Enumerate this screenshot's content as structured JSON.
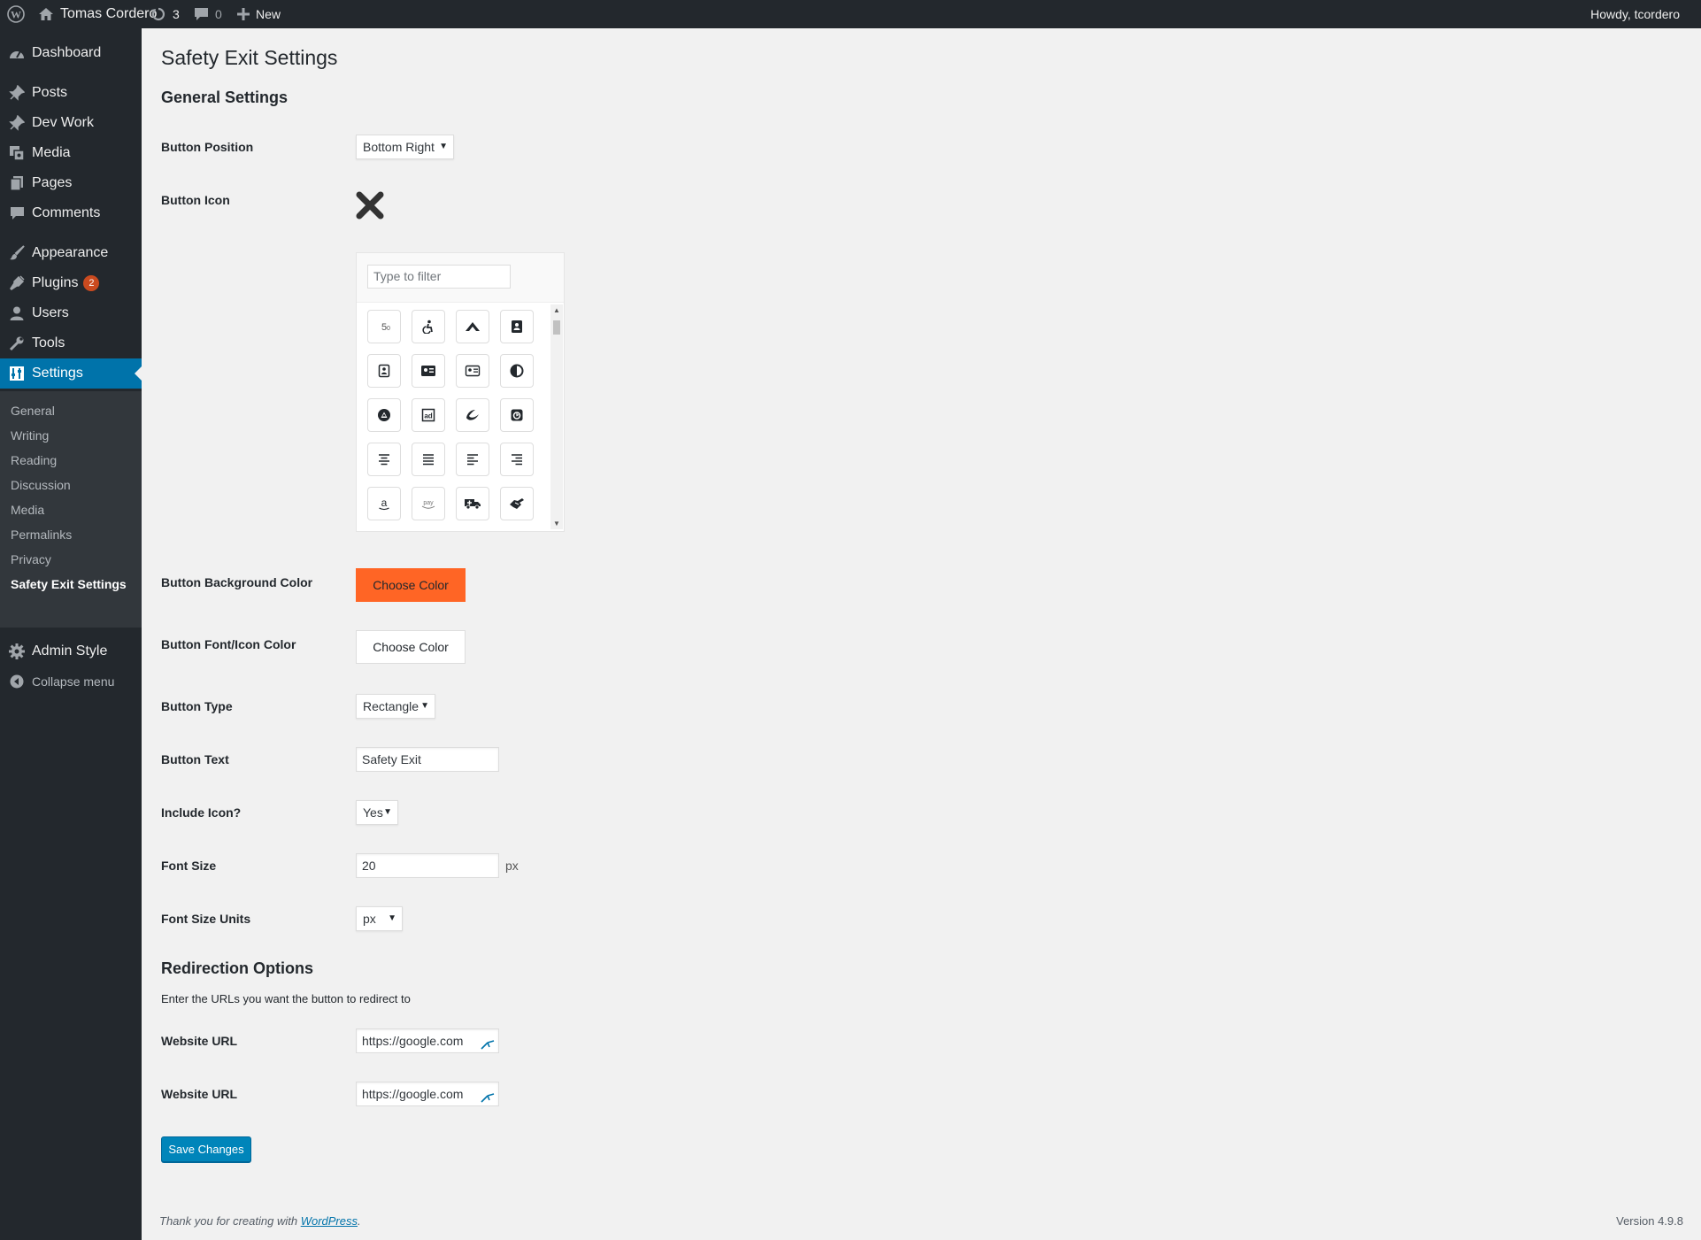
{
  "admin_bar": {
    "site_name": "Tomas Cordero",
    "updates_count": "3",
    "comments_count": "0",
    "new_label": "New",
    "greeting": "Howdy, tcordero"
  },
  "sidebar": {
    "items": [
      {
        "label": "Dashboard",
        "icon": "dashboard-icon"
      },
      {
        "label": "Posts",
        "icon": "pin-icon"
      },
      {
        "label": "Dev Work",
        "icon": "pin-icon"
      },
      {
        "label": "Media",
        "icon": "media-icon"
      },
      {
        "label": "Pages",
        "icon": "pages-icon"
      },
      {
        "label": "Comments",
        "icon": "comment-icon"
      },
      {
        "label": "Appearance",
        "icon": "brush-icon"
      },
      {
        "label": "Plugins",
        "icon": "plugin-icon",
        "badge": "2"
      },
      {
        "label": "Users",
        "icon": "user-icon"
      },
      {
        "label": "Tools",
        "icon": "wrench-icon"
      },
      {
        "label": "Settings",
        "icon": "settings-icon"
      }
    ],
    "submenu": [
      "General",
      "Writing",
      "Reading",
      "Discussion",
      "Media",
      "Permalinks",
      "Privacy",
      "Safety Exit Settings"
    ],
    "admin_style": "Admin Style",
    "collapse": "Collapse menu"
  },
  "page": {
    "title": "Safety Exit Settings",
    "general_heading": "General Settings",
    "button_position_label": "Button Position",
    "button_position_value": "Bottom Right",
    "button_icon_label": "Button Icon",
    "filter_placeholder": "Type to filter",
    "icon_grid": [
      [
        "500px-icon",
        "accessible-icon",
        "accusoft-icon",
        "address-book-icon"
      ],
      [
        "address-card-icon",
        "address-card-solid-icon",
        "id-card-icon",
        "adjust-icon"
      ],
      [
        "adn-icon",
        "adversal-icon",
        "affiliatetheme-icon",
        "algolia-icon"
      ],
      [
        "align-center-icon",
        "align-justify-icon",
        "align-left-icon",
        "align-right-icon"
      ],
      [
        "amazon-icon",
        "amazon-pay-icon",
        "ambulance-icon",
        "american-sign-language-icon"
      ]
    ],
    "bg_color_label": "Button Background Color",
    "bg_color_button": "Choose Color",
    "bg_color_value": "#ff6525",
    "font_color_label": "Button Font/Icon Color",
    "font_color_button": "Choose Color",
    "font_color_value": "#ffffff",
    "button_type_label": "Button Type",
    "button_type_value": "Rectangle",
    "button_text_label": "Button Text",
    "button_text_value": "Safety Exit",
    "include_icon_label": "Include Icon?",
    "include_icon_value": "Yes",
    "font_size_label": "Font Size",
    "font_size_value": "20",
    "font_size_suffix": "px",
    "font_size_units_label": "Font Size Units",
    "font_size_units_value": "px",
    "redirect_heading": "Redirection Options",
    "redirect_description": "Enter the URLs you want the button to redirect to",
    "website_url_label_1": "Website URL",
    "website_url_value_1": "https://google.com",
    "website_url_label_2": "Website URL",
    "website_url_value_2": "https://google.com",
    "save_label": "Save Changes"
  },
  "footer": {
    "thanks_prefix": "Thank you for creating with ",
    "wordpress_link": "WordPress",
    "thanks_suffix": ".",
    "version": "Version 4.9.8"
  },
  "colors": {
    "admin_bar_bg": "#23282d",
    "menu_active": "#0073aa",
    "primary_button": "#0085ba"
  }
}
